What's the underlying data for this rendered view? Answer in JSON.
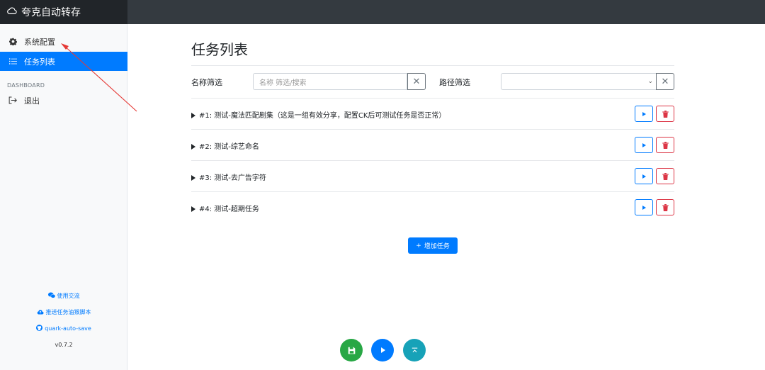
{
  "app": {
    "title": "夸克自动转存"
  },
  "sidebar": {
    "items": [
      {
        "label": "系统配置",
        "icon": "gear-icon"
      },
      {
        "label": "任务列表",
        "icon": "list-icon",
        "active": true
      }
    ],
    "section_heading": "DASHBOARD",
    "logout_label": "退出",
    "footer_links": [
      {
        "label": "使用交流",
        "icon": "wechat-icon"
      },
      {
        "label": "推送任务油猴脚本",
        "icon": "cloud-icon"
      },
      {
        "label": "quark-auto-save",
        "icon": "github-icon"
      }
    ],
    "version": "v0.7.2"
  },
  "main": {
    "title": "任务列表",
    "filters": {
      "name_label": "名称筛选",
      "name_placeholder": "名称 筛选/搜索",
      "path_label": "路径筛选",
      "path_value": ""
    },
    "tasks": [
      {
        "label": "#1: 测试-魔法匹配剧集（这是一组有效分享，配置CK后可测试任务是否正常）"
      },
      {
        "label": "#2: 测试-综艺命名"
      },
      {
        "label": "#3: 测试-去广告字符"
      },
      {
        "label": "#4: 测试-超期任务"
      }
    ],
    "add_task_label": "增加任务"
  },
  "colors": {
    "primary": "#007bff",
    "danger": "#dc3545",
    "success": "#28a745",
    "info": "#17a2b8",
    "annotation": "#e53935"
  }
}
